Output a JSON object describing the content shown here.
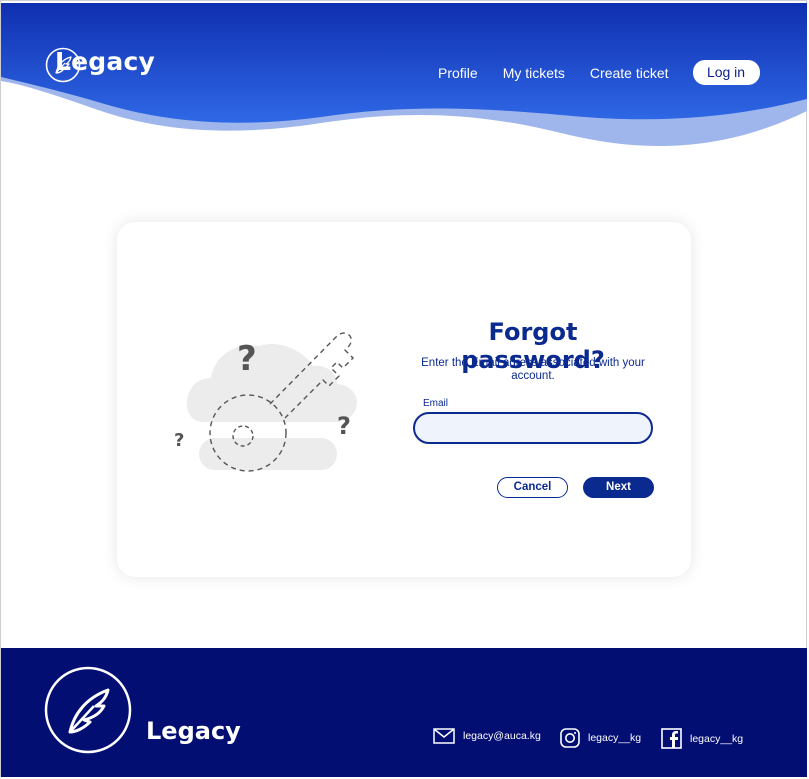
{
  "brand": {
    "name": "Legacy"
  },
  "nav": {
    "links": [
      "Profile",
      "My tickets",
      "Create ticket"
    ],
    "login_label": "Log in"
  },
  "form": {
    "title": "Forgot password?",
    "subtitle": "Enter the Email adress associated with your account.",
    "email_label": "Email",
    "email_value": "",
    "cancel_label": "Cancel",
    "next_label": "Next"
  },
  "footer": {
    "name": "Legacy",
    "email": "legacy@auca.kg",
    "instagram": "legacy__kg",
    "facebook": "legacy__kg"
  },
  "colors": {
    "header_blue": "#2a5ee0",
    "primary": "#0b2a8f",
    "footer_bg": "#030e73"
  },
  "icons": [
    "feather-logo-icon",
    "key-illustration",
    "mail-icon",
    "instagram-icon",
    "facebook-icon"
  ]
}
